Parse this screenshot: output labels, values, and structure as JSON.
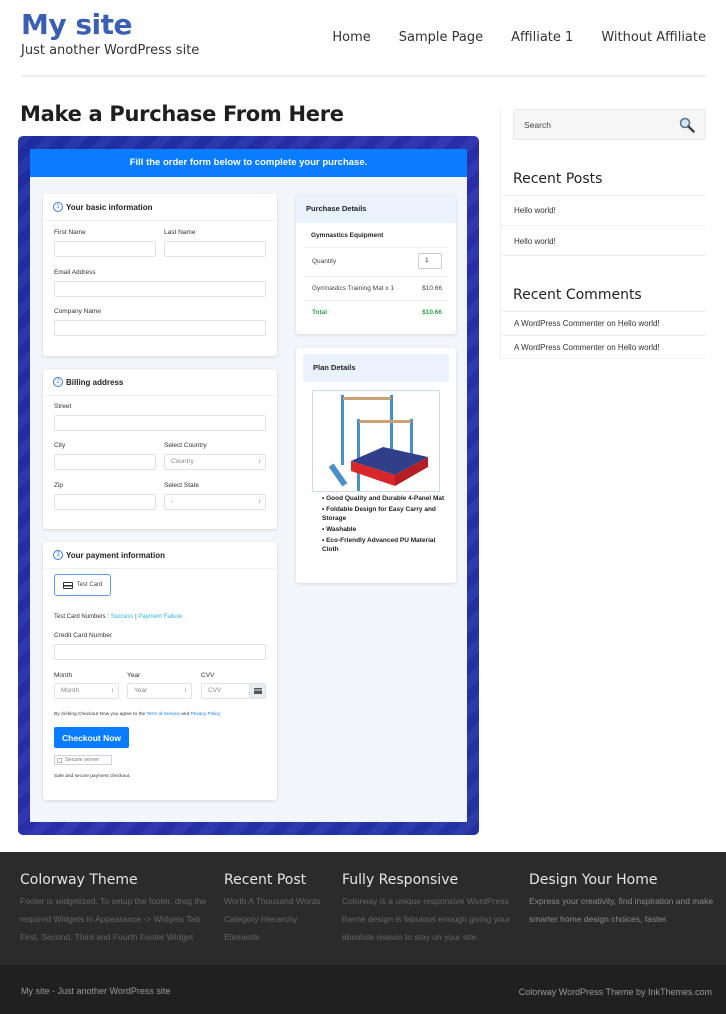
{
  "site": {
    "title": "My site",
    "tagline": "Just another WordPress site",
    "brand_color": "#3a5fb5"
  },
  "nav": {
    "items": [
      {
        "label": "Home"
      },
      {
        "label": "Sample Page"
      },
      {
        "label": "Affiliate 1"
      },
      {
        "label": "Without Affiliate"
      }
    ]
  },
  "main": {
    "page_title": "Make a Purchase From Here",
    "form": {
      "banner": "Fill the order form below to complete your purchase.",
      "banner_color": "#0a7cff",
      "basic_info": {
        "step": "1",
        "title": "Your basic information",
        "first_name_label": "First Name",
        "last_name_label": "Last Name",
        "email_label": "Email Address",
        "company_label": "Company Name",
        "first_name_value": "",
        "last_name_value": "",
        "email_value": "",
        "company_value": ""
      },
      "billing": {
        "step": "2",
        "title": "Billing address",
        "street_label": "Street",
        "city_label": "City",
        "country_label": "Select Country",
        "country_value": "Country",
        "zip_label": "Zip",
        "state_label": "Select State",
        "state_value": "-"
      },
      "payment": {
        "step": "3",
        "title": "Your payment information",
        "method_label": "Test Card",
        "test_numbers_prefix": "Test Card Numbers :",
        "success_link": "Success",
        "separator": "|",
        "failure_link": "Payment Failure",
        "card_number_label": "Credit Card Number",
        "month_label": "Month",
        "month_value": "Month",
        "year_label": "Year",
        "year_value": "Year",
        "cvv_label": "CVV",
        "cvv_placeholder": "CVV",
        "agree_prefix": "By clicking Checkout Now you agree to the",
        "terms_link": "Term of Service",
        "agree_and": "and",
        "privacy_link": "Privacy Policy",
        "checkout_label": "Checkout Now",
        "secure_label": "Secure server",
        "safe_text": "Safe and secure payment checkout."
      },
      "purchase_details": {
        "title": "Purchase Details",
        "product_group": "Gymnastics Equipment",
        "quantity_label": "Quantity",
        "quantity_value": "1",
        "line_item": "Gymnastics Training Mat x 1",
        "line_price": "$10.66",
        "total_label": "Total",
        "total_value": "$10.66",
        "total_color": "#2ea44f"
      },
      "plan_details": {
        "title": "Plan Details",
        "image_alt": "gymnastics bars and mat",
        "features": [
          "Good Quality and Durable 4-Panel Mat",
          "Foldable Design for Easy Carry and Storage",
          "Washable",
          "Eco-Friendly Advanced PU Material Cloth"
        ]
      }
    }
  },
  "sidebar": {
    "search_placeholder": "Search",
    "recent_posts_title": "Recent Posts",
    "recent_posts": [
      "Hello world!",
      "Hello world!"
    ],
    "recent_comments_title": "Recent Comments",
    "recent_comments": [
      {
        "author": "A WordPress Commenter",
        "on": "on",
        "post": "Hello world!"
      },
      {
        "author": "A WordPress Commenter",
        "on": "on",
        "post": "Hello world!"
      }
    ]
  },
  "footer": {
    "columns": [
      {
        "title": "Colorway Theme",
        "lines": [
          "Footer is widgetized. To setup the footer, drag the",
          "required Widgets in Appearance -> Widgets Tab",
          "First, Second, Third and Fourth Footer Widget"
        ]
      },
      {
        "title": "Recent Post",
        "lines": [
          "Worth A Thousand Words",
          "Category Hierarchy",
          "Elements"
        ]
      },
      {
        "title": "Fully Responsive",
        "lines": [
          "Colorway is a unique responsive WordPress",
          "theme design is fabulous enough giving your",
          "absolute reason to stay on your site."
        ]
      },
      {
        "title": "Design Your Home",
        "lines": [
          "Express your creativity, find inspiration and make",
          "smarter home design choices, faster."
        ]
      }
    ],
    "copyright_left": "My site - Just another WordPress site",
    "copyright_right": "Colorway WordPress Theme by InkThemes.com"
  }
}
